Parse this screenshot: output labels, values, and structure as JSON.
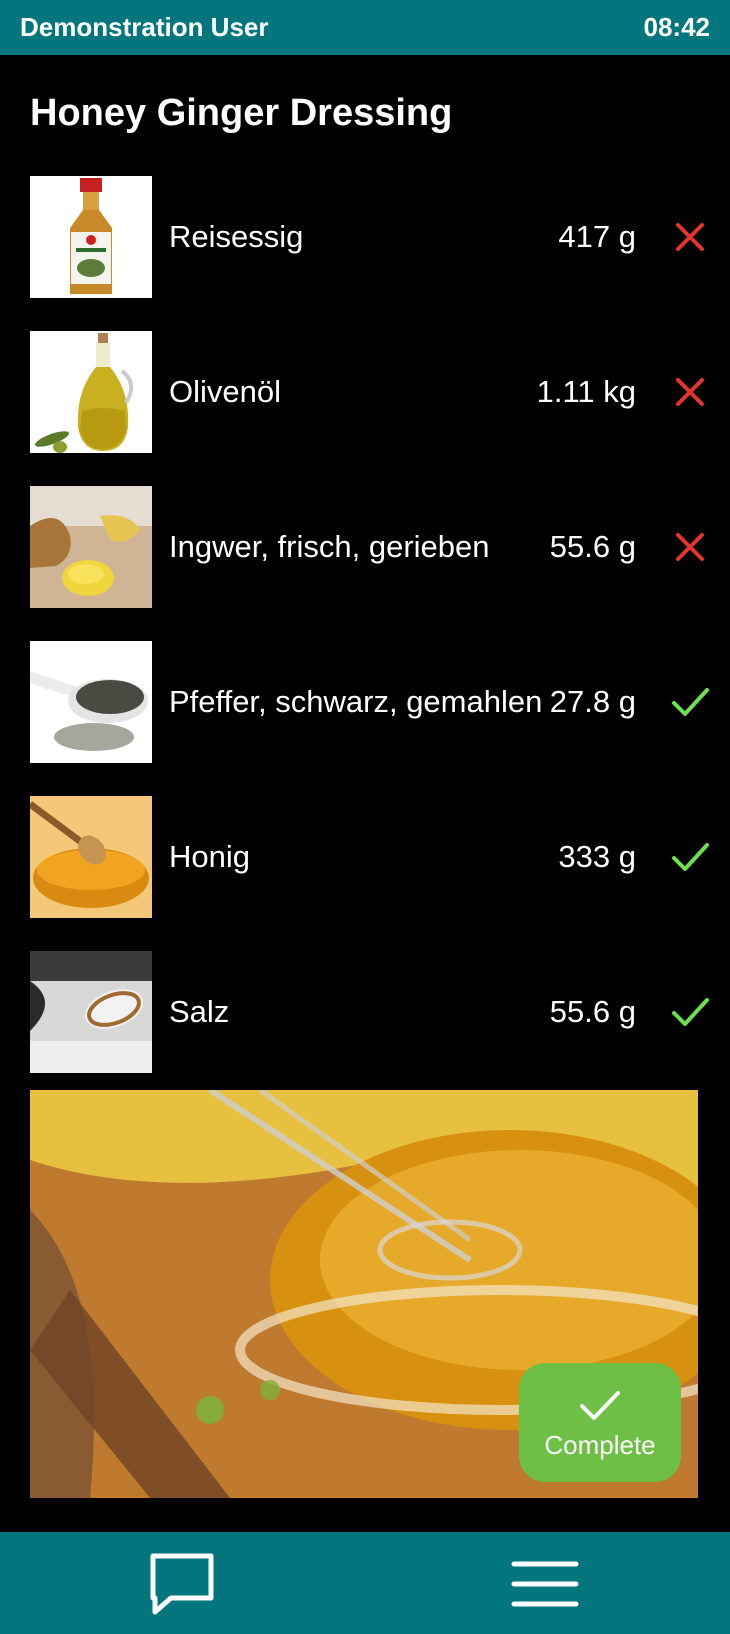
{
  "status_bar": {
    "user": "Demonstration User",
    "time": "08:42"
  },
  "recipe": {
    "title": "Honey Ginger Dressing"
  },
  "ingredients": [
    {
      "name": "Reisessig",
      "amount": "417 g",
      "status": "missing",
      "icon": "rice-vinegar-bottle-image"
    },
    {
      "name": "Olivenöl",
      "amount": "1.11 kg",
      "status": "missing",
      "icon": "olive-oil-image"
    },
    {
      "name": "Ingwer, frisch, gerieben",
      "amount": "55.6 g",
      "status": "missing",
      "icon": "ginger-image"
    },
    {
      "name": "Pfeffer, schwarz, gemahlen",
      "amount": "27.8 g",
      "status": "done",
      "icon": "pepper-image"
    },
    {
      "name": "Honig",
      "amount": "333 g",
      "status": "done",
      "icon": "honey-image"
    },
    {
      "name": "Salz",
      "amount": "55.6 g",
      "status": "done",
      "icon": "salt-image"
    }
  ],
  "colors": {
    "teal": "#02767C",
    "cross": "#E5362B",
    "check": "#6DE04F",
    "button": "#6DBF45"
  },
  "complete_button": {
    "label": "Complete"
  },
  "bottom_nav": {
    "chat_icon": "chat-icon",
    "menu_icon": "menu-icon"
  }
}
